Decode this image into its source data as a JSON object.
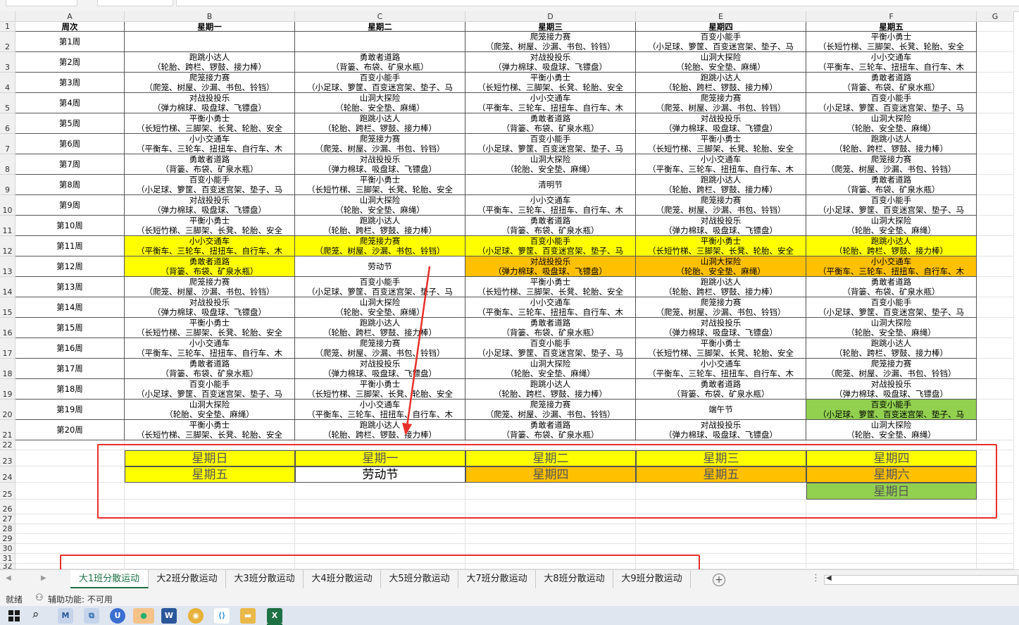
{
  "columns": [
    "A",
    "B",
    "C",
    "D",
    "E",
    "F",
    "G"
  ],
  "header_row": [
    "周次",
    "星期一",
    "星期二",
    "星期三",
    "星期四",
    "星期五"
  ],
  "weeks": [
    {
      "week": "第1周",
      "days": [
        [
          "",
          ""
        ],
        [
          "",
          ""
        ],
        [
          "爬笼接力赛",
          "（爬笼、树屋、沙漏、书包、铃铛）"
        ],
        [
          "百变小能手",
          "（小足球、箩筐、百变迷宫架、垫子、马"
        ],
        [
          "平衡小勇士",
          "（长短竹梯、三脚架、长凳、轮胎、安全"
        ]
      ]
    },
    {
      "week": "第2周",
      "days": [
        [
          "跑跳小达人",
          "（轮胎、跨栏、锣鼓、接力棒）"
        ],
        [
          "勇敢者道路",
          "（背篓、布袋、矿泉水瓶）"
        ],
        [
          "对战投投乐",
          "（弹力棉球、吸盘球、飞镖盘）"
        ],
        [
          "山洞大探险",
          "（轮胎、安全垫、麻绳）"
        ],
        [
          "小小交通车",
          "（平衡车、三轮车、扭扭车、自行车、木"
        ]
      ]
    },
    {
      "week": "第3周",
      "days": [
        [
          "爬笼接力赛",
          "（爬笼、树屋、沙漏、书包、铃铛）"
        ],
        [
          "百变小能手",
          "（小足球、箩筐、百变迷宫架、垫子、马"
        ],
        [
          "平衡小勇士",
          "（长短竹梯、三脚架、长凳、轮胎、安全"
        ],
        [
          "跑跳小达人",
          "（轮胎、跨栏、锣鼓、接力棒）"
        ],
        [
          "勇敢者道路",
          "（背篓、布袋、矿泉水瓶）"
        ]
      ]
    },
    {
      "week": "第4周",
      "days": [
        [
          "对战投投乐",
          "（弹力棉球、吸盘球、飞镖盘）"
        ],
        [
          "山洞大探险",
          "（轮胎、安全垫、麻绳）"
        ],
        [
          "小小交通车",
          "（平衡车、三轮车、扭扭车、自行车、木"
        ],
        [
          "爬笼接力赛",
          "（爬笼、树屋、沙漏、书包、铃铛）"
        ],
        [
          "百变小能手",
          "（小足球、箩筐、百变迷宫架、垫子、马"
        ]
      ]
    },
    {
      "week": "第5周",
      "days": [
        [
          "平衡小勇士",
          "（长短竹梯、三脚架、长凳、轮胎、安全"
        ],
        [
          "跑跳小达人",
          "（轮胎、跨栏、锣鼓、接力棒）"
        ],
        [
          "勇敢者道路",
          "（背篓、布袋、矿泉水瓶）"
        ],
        [
          "对战投投乐",
          "（弹力棉球、吸盘球、飞镖盘）"
        ],
        [
          "山洞大探险",
          "（轮胎、安全垫、麻绳）"
        ]
      ]
    },
    {
      "week": "第6周",
      "days": [
        [
          "小小交通车",
          "（平衡车、三轮车、扭扭车、自行车、木"
        ],
        [
          "爬笼接力赛",
          "（爬笼、树屋、沙漏、书包、铃铛）"
        ],
        [
          "百变小能手",
          "（小足球、箩筐、百变迷宫架、垫子、马"
        ],
        [
          "平衡小勇士",
          "（长短竹梯、三脚架、长凳、轮胎、安全"
        ],
        [
          "跑跳小达人",
          "（轮胎、跨栏、锣鼓、接力棒）"
        ]
      ]
    },
    {
      "week": "第7周",
      "days": [
        [
          "勇敢者道路",
          "（背篓、布袋、矿泉水瓶）"
        ],
        [
          "对战投投乐",
          "（弹力棉球、吸盘球、飞镖盘）"
        ],
        [
          "山洞大探险",
          "（轮胎、安全垫、麻绳）"
        ],
        [
          "小小交通车",
          "（平衡车、三轮车、扭扭车、自行车、木"
        ],
        [
          "爬笼接力赛",
          "（爬笼、树屋、沙漏、书包、铃铛）"
        ]
      ]
    },
    {
      "week": "第8周",
      "days": [
        [
          "百变小能手",
          "（小足球、箩筐、百变迷宫架、垫子、马"
        ],
        [
          "平衡小勇士",
          "（长短竹梯、三脚架、长凳、轮胎、安全"
        ],
        [
          "清明节",
          ""
        ],
        [
          "跑跳小达人",
          "（轮胎、跨栏、锣鼓、接力棒）"
        ],
        [
          "勇敢者道路",
          "（背篓、布袋、矿泉水瓶）"
        ]
      ]
    },
    {
      "week": "第9周",
      "days": [
        [
          "对战投投乐",
          "（弹力棉球、吸盘球、飞镖盘）"
        ],
        [
          "山洞大探险",
          "（轮胎、安全垫、麻绳）"
        ],
        [
          "小小交通车",
          "（平衡车、三轮车、扭扭车、自行车、木"
        ],
        [
          "爬笼接力赛",
          "（爬笼、树屋、沙漏、书包、铃铛）"
        ],
        [
          "百变小能手",
          "（小足球、箩筐、百变迷宫架、垫子、马"
        ]
      ]
    },
    {
      "week": "第10周",
      "days": [
        [
          "平衡小勇士",
          "（长短竹梯、三脚架、长凳、轮胎、安全"
        ],
        [
          "跑跳小达人",
          "（轮胎、跨栏、锣鼓、接力棒）"
        ],
        [
          "勇敢者道路",
          "（背篓、布袋、矿泉水瓶）"
        ],
        [
          "对战投投乐",
          "（弹力棉球、吸盘球、飞镖盘）"
        ],
        [
          "山洞大探险",
          "（轮胎、安全垫、麻绳）"
        ]
      ]
    },
    {
      "week": "第11周",
      "days": [
        [
          "小小交通车",
          "（平衡车、三轮车、扭扭车、自行车、木"
        ],
        [
          "爬笼接力赛",
          "（爬笼、树屋、沙漏、书包、铃铛）"
        ],
        [
          "百变小能手",
          "（小足球、箩筐、百变迷宫架、垫子、马"
        ],
        [
          "平衡小勇士",
          "（长短竹梯、三脚架、长凳、轮胎、安全"
        ],
        [
          "跑跳小达人",
          "（轮胎、跨栏、锣鼓、接力棒）"
        ]
      ]
    },
    {
      "week": "第12周",
      "days": [
        [
          "勇敢者道路",
          "（背篓、布袋、矿泉水瓶）"
        ],
        [
          "劳动节",
          ""
        ],
        [
          "对战投投乐",
          "（弹力棉球、吸盘球、飞镖盘）"
        ],
        [
          "山洞大探险",
          "（轮胎、安全垫、麻绳）"
        ],
        [
          "小小交通车",
          "（平衡车、三轮车、扭扭车、自行车、木"
        ]
      ]
    },
    {
      "week": "第13周",
      "days": [
        [
          "爬笼接力赛",
          "（爬笼、树屋、沙漏、书包、铃铛）"
        ],
        [
          "百变小能手",
          "（小足球、箩筐、百变迷宫架、垫子、马"
        ],
        [
          "平衡小勇士",
          "（长短竹梯、三脚架、长凳、轮胎、安全"
        ],
        [
          "跑跳小达人",
          "（轮胎、跨栏、锣鼓、接力棒）"
        ],
        [
          "勇敢者道路",
          "（背篓、布袋、矿泉水瓶）"
        ]
      ]
    },
    {
      "week": "第14周",
      "days": [
        [
          "对战投投乐",
          "（弹力棉球、吸盘球、飞镖盘）"
        ],
        [
          "山洞大探险",
          "（轮胎、安全垫、麻绳）"
        ],
        [
          "小小交通车",
          "（平衡车、三轮车、扭扭车、自行车、木"
        ],
        [
          "爬笼接力赛",
          "（爬笼、树屋、沙漏、书包、铃铛）"
        ],
        [
          "百变小能手",
          "（小足球、箩筐、百变迷宫架、垫子、马"
        ]
      ]
    },
    {
      "week": "第15周",
      "days": [
        [
          "平衡小勇士",
          "（长短竹梯、三脚架、长凳、轮胎、安全"
        ],
        [
          "跑跳小达人",
          "（轮胎、跨栏、锣鼓、接力棒）"
        ],
        [
          "勇敢者道路",
          "（背篓、布袋、矿泉水瓶）"
        ],
        [
          "对战投投乐",
          "（弹力棉球、吸盘球、飞镖盘）"
        ],
        [
          "山洞大探险",
          "（轮胎、安全垫、麻绳）"
        ]
      ]
    },
    {
      "week": "第16周",
      "days": [
        [
          "小小交通车",
          "（平衡车、三轮车、扭扭车、自行车、木"
        ],
        [
          "爬笼接力赛",
          "（爬笼、树屋、沙漏、书包、铃铛）"
        ],
        [
          "百变小能手",
          "（小足球、箩筐、百变迷宫架、垫子、马"
        ],
        [
          "平衡小勇士",
          "（长短竹梯、三脚架、长凳、轮胎、安全"
        ],
        [
          "跑跳小达人",
          "（轮胎、跨栏、锣鼓、接力棒）"
        ]
      ]
    },
    {
      "week": "第17周",
      "days": [
        [
          "勇敢者道路",
          "（背篓、布袋、矿泉水瓶）"
        ],
        [
          "对战投投乐",
          "（弹力棉球、吸盘球、飞镖盘）"
        ],
        [
          "山洞大探险",
          "（轮胎、安全垫、麻绳）"
        ],
        [
          "小小交通车",
          "（平衡车、三轮车、扭扭车、自行车、木"
        ],
        [
          "爬笼接力赛",
          "（爬笼、树屋、沙漏、书包、铃铛）"
        ]
      ]
    },
    {
      "week": "第18周",
      "days": [
        [
          "百变小能手",
          "（小足球、箩筐、百变迷宫架、垫子、马"
        ],
        [
          "平衡小勇士",
          "（长短竹梯、三脚架、长凳、轮胎、安全"
        ],
        [
          "跑跳小达人",
          "（轮胎、跨栏、锣鼓、接力棒）"
        ],
        [
          "勇敢者道路",
          "（背篓、布袋、矿泉水瓶）"
        ],
        [
          "对战投投乐",
          "（弹力棉球、吸盘球、飞镖盘）"
        ]
      ]
    },
    {
      "week": "第19周",
      "days": [
        [
          "山洞大探险",
          "（轮胎、安全垫、麻绳）"
        ],
        [
          "小小交通车",
          "（平衡车、三轮车、扭扭车、自行车、木"
        ],
        [
          "爬笼接力赛",
          "（爬笼、树屋、沙漏、书包、铃铛）"
        ],
        [
          "端午节",
          ""
        ],
        [
          "百变小能手",
          "（小足球、箩筐、百变迷宫架、垫子、马"
        ]
      ]
    },
    {
      "week": "第20周",
      "days": [
        [
          "平衡小勇士",
          "（长短竹梯、三脚架、长凳、轮胎、安全"
        ],
        [
          "跑跳小达人",
          "（轮胎、跨栏、锣鼓、接力棒）"
        ],
        [
          "勇敢者道路",
          "（背篓、布袋、矿泉水瓶）"
        ],
        [
          "对战投投乐",
          "（弹力棉球、吸盘球、飞镖盘）"
        ],
        [
          "山洞大探险",
          "（轮胎、安全垫、麻绳）"
        ]
      ]
    }
  ],
  "highlights": {
    "yellow": "#ffff00",
    "orange": "#ffc000",
    "green": "#92d050",
    "cells": [
      {
        "week": 11,
        "day": 1,
        "color": "yellow"
      },
      {
        "week": 11,
        "day": 2,
        "color": "yellow"
      },
      {
        "week": 11,
        "day": 3,
        "color": "yellow"
      },
      {
        "week": 11,
        "day": 4,
        "color": "yellow"
      },
      {
        "week": 11,
        "day": 5,
        "color": "yellow"
      },
      {
        "week": 12,
        "day": 1,
        "color": "yellow"
      },
      {
        "week": 12,
        "day": 3,
        "color": "orange"
      },
      {
        "week": 12,
        "day": 4,
        "color": "orange"
      },
      {
        "week": 12,
        "day": 5,
        "color": "orange"
      },
      {
        "week": 19,
        "day": 5,
        "color": "green"
      }
    ]
  },
  "legend": {
    "row23": [
      "星期日",
      "星期一",
      "星期二",
      "星期三",
      "星期四"
    ],
    "row24": [
      "星期五",
      "劳动节",
      "星期四",
      "星期五",
      "星期六"
    ],
    "row25": [
      "",
      "",
      "",
      "",
      "星期日"
    ]
  },
  "sheet_tabs": [
    "大1班分散运动",
    "大2班分散运动",
    "大3班分散运动",
    "大4班分散运动",
    "大5班分散运动",
    "大7班分散运动",
    "大8班分散运动",
    "大9班分散运动"
  ],
  "active_tab": 0,
  "status": {
    "ready": "就绪",
    "accessibility": "辅助功能: 不可用"
  },
  "taskbar_apps": [
    "windows-start-icon",
    "search-icon",
    "app-icon",
    "app-icon-2",
    "ub-icon",
    "wechat-icon",
    "word-icon",
    "chrome-icon",
    "vscode-icon",
    "folder-icon",
    "excel-icon"
  ]
}
